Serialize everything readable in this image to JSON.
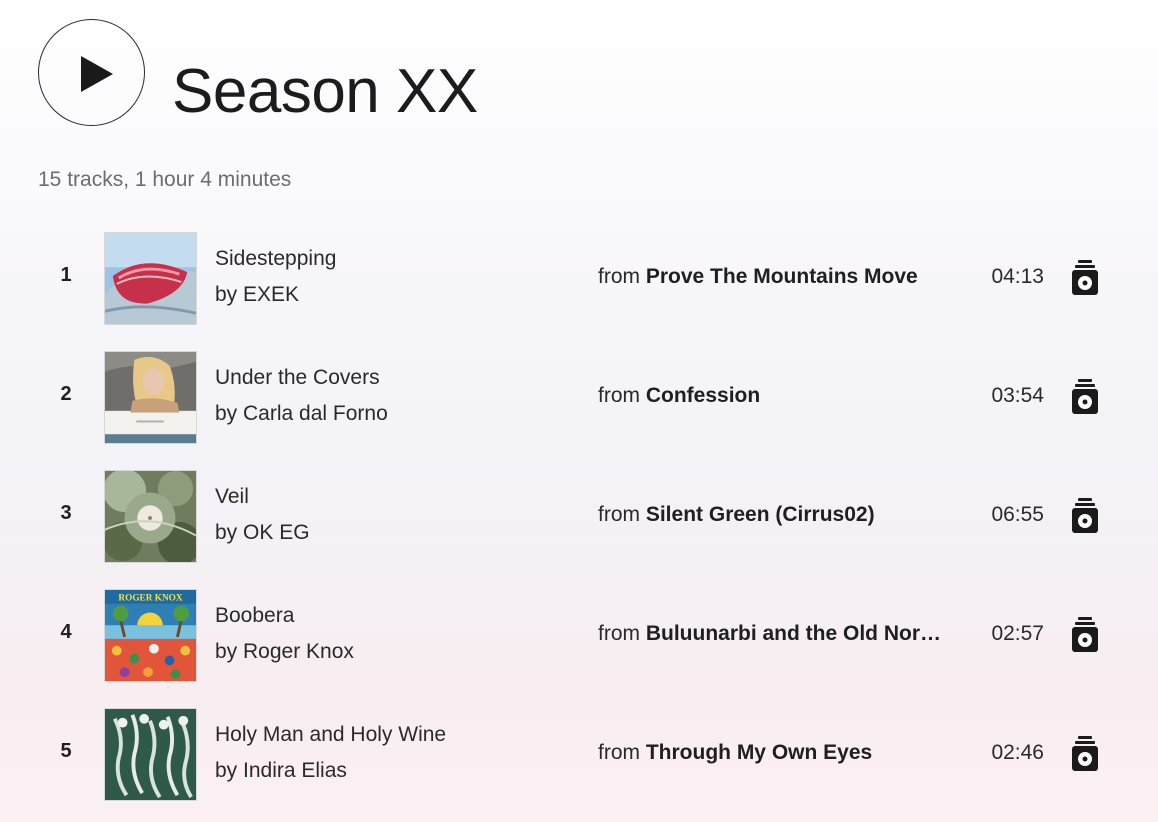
{
  "playlist": {
    "title": "Season XX",
    "summary": "15 tracks, 1 hour 4 minutes"
  },
  "icons": {
    "play": "play-icon",
    "radio": "radio-icon"
  },
  "colors": {
    "text": "#1f1f1f",
    "muted": "#6d6d6d"
  },
  "tracks": [
    {
      "number": "1",
      "title": "Sidestepping",
      "artist": "by EXEK",
      "from": "from",
      "album": "Prove The Mountains Move",
      "duration": "04:13"
    },
    {
      "number": "2",
      "title": "Under the Covers",
      "artist": "by Carla dal Forno",
      "from": "from",
      "album": "Confession",
      "duration": "03:54"
    },
    {
      "number": "3",
      "title": "Veil",
      "artist": "by OK EG",
      "from": "from",
      "album": "Silent Green (Cirrus02)",
      "duration": "06:55"
    },
    {
      "number": "4",
      "title": "Boobera",
      "artist": "by Roger Knox",
      "from": "from",
      "album": "Buluunarbi and the Old Nor…",
      "duration": "02:57",
      "art_text": "ROGER KNOX"
    },
    {
      "number": "5",
      "title": "Holy Man and Holy Wine",
      "artist": "by Indira Elias",
      "from": "from",
      "album": "Through My Own Eyes",
      "duration": "02:46"
    }
  ]
}
